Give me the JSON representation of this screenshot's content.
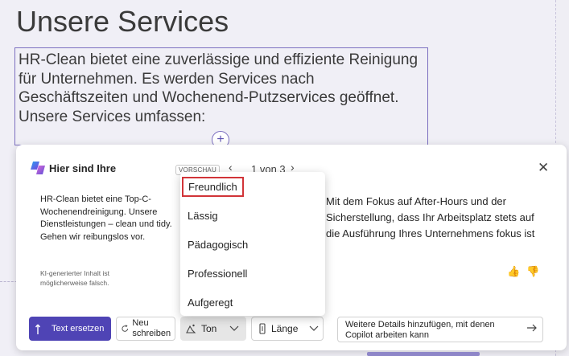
{
  "slide": {
    "title": "Unsere Services",
    "body": "HR-Clean bietet eine zuverlässige und effiziente Reinigung für Unternehmen. Es werden Services nach Geschäftszeiten und Wochenend-Putzservices geöffnet. Unsere Services umfassen:"
  },
  "copilot": {
    "title": "Hier sind Ihre",
    "badge": "VORSCHAU",
    "nav": {
      "prev": "‹",
      "count": "1 von 3",
      "next": "›"
    },
    "close": "✕",
    "left_text": "HR-Clean bietet eine Top-C-Wochenendreinigung. Unsere Dienstleistungen – clean und tidy. Gehen wir reibungslos vor.",
    "disclaimer": "KI-generierter Inhalt ist möglicherweise falsch.",
    "right_text": "Mit dem Fokus auf After-Hours und der Sicherstellung, dass Ihr Arbeitsplatz stets auf die Ausführung Ihres Unternehmens fokus ist",
    "thumbs_up": "👍",
    "thumbs_down": "👎"
  },
  "toolbar": {
    "replace_label": "Text ersetzen",
    "rewrite_label": "Neu schreiben",
    "tone_label": "Ton",
    "length_label": "Länge",
    "details_placeholder": "Weitere Details hinzufügen, mit denen Copilot arbeiten kann"
  },
  "tone_menu": {
    "items": [
      "Freundlich",
      "Lässig",
      "Pädagogisch",
      "Professionell",
      "Aufgeregt"
    ],
    "selected": "Freundlich"
  },
  "colors": {
    "accent": "#4f44b5",
    "selection_border": "#d13438",
    "text_frame": "#7c6fc0"
  },
  "icons": {
    "copilot": "copilot-icon",
    "replace": "arrow-up-icon",
    "rewrite": "refresh-icon",
    "tone": "tone-icon",
    "length": "length-icon",
    "send": "arrow-right-icon",
    "chevron": "chevron-down-icon"
  }
}
